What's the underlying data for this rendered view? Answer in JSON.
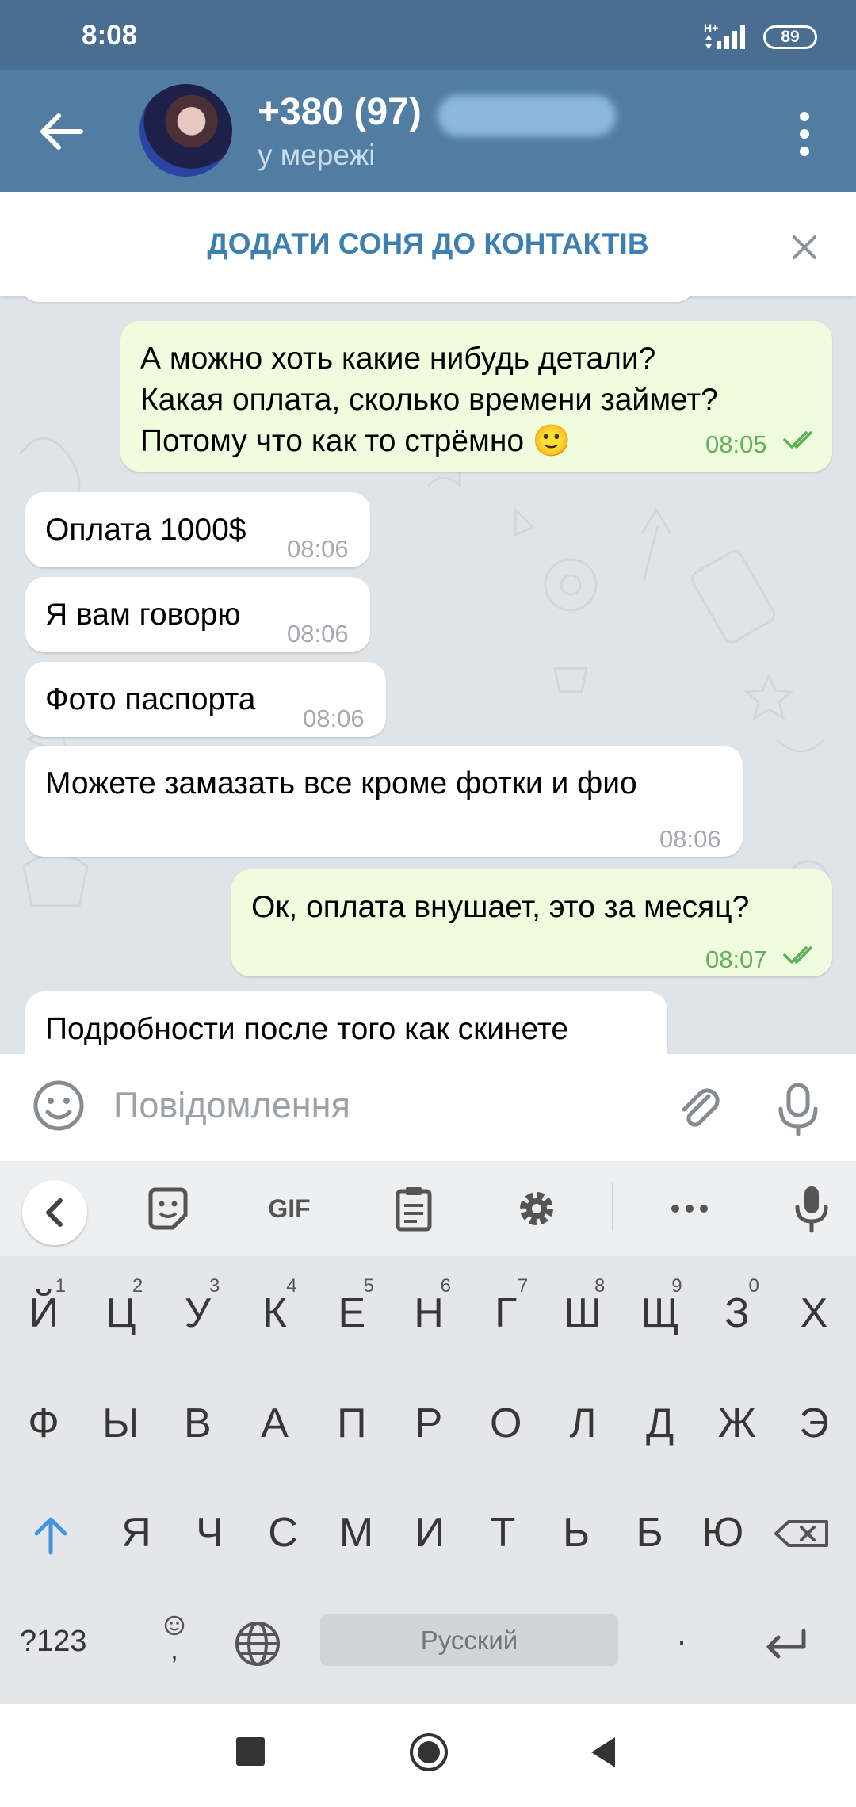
{
  "status_bar": {
    "time": "8:08",
    "network": "H+",
    "battery": "89"
  },
  "header": {
    "contact_name": "+380 (97)",
    "status": "у мережі"
  },
  "banner": {
    "add_contact": "ДОДАТИ СОНЯ ДО КОНТАКТІВ"
  },
  "messages": [
    {
      "direction": "out",
      "text": "А можно хоть какие нибудь детали?\nКакая оплата, сколько времени займет?\nПотому что как то стрёмно 🙂",
      "time": "08:05",
      "read": true
    },
    {
      "direction": "in",
      "text": "Оплата 1000$",
      "time": "08:06"
    },
    {
      "direction": "in",
      "text": "Я вам говорю",
      "time": "08:06"
    },
    {
      "direction": "in",
      "text": "Фото паспорта",
      "time": "08:06"
    },
    {
      "direction": "in",
      "text": "Можете замазать все кроме фотки и фио",
      "time": "08:06"
    },
    {
      "direction": "out",
      "text": "Ок, оплата внушает, это за месяц?",
      "time": "08:07",
      "read": true
    },
    {
      "direction": "in",
      "text": "Подробности после того как скинете",
      "time": ""
    }
  ],
  "input": {
    "placeholder": "Повідомлення"
  },
  "keyboard": {
    "toolbar": {
      "gif": "GIF"
    },
    "row1": [
      "Й",
      "Ц",
      "У",
      "К",
      "Е",
      "Н",
      "Г",
      "Ш",
      "Щ",
      "З",
      "Х"
    ],
    "row1_hints": [
      "1",
      "2",
      "3",
      "4",
      "5",
      "6",
      "7",
      "8",
      "9",
      "0",
      ""
    ],
    "row2": [
      "Ф",
      "Ы",
      "В",
      "А",
      "П",
      "Р",
      "О",
      "Л",
      "Д",
      "Ж",
      "Э"
    ],
    "row3": [
      "Я",
      "Ч",
      "С",
      "М",
      "И",
      "Т",
      "Ь",
      "Б",
      "Ю"
    ],
    "symbols": "?123",
    "space": "Русский",
    "emoji_comma": ",",
    "period": "."
  },
  "colors": {
    "header": "#517da2",
    "status_bar": "#4a6e92",
    "outgoing": "#effdde",
    "incoming": "#ffffff",
    "accent": "#3e7fb2",
    "check": "#66ad5e",
    "shift": "#3f96df"
  }
}
